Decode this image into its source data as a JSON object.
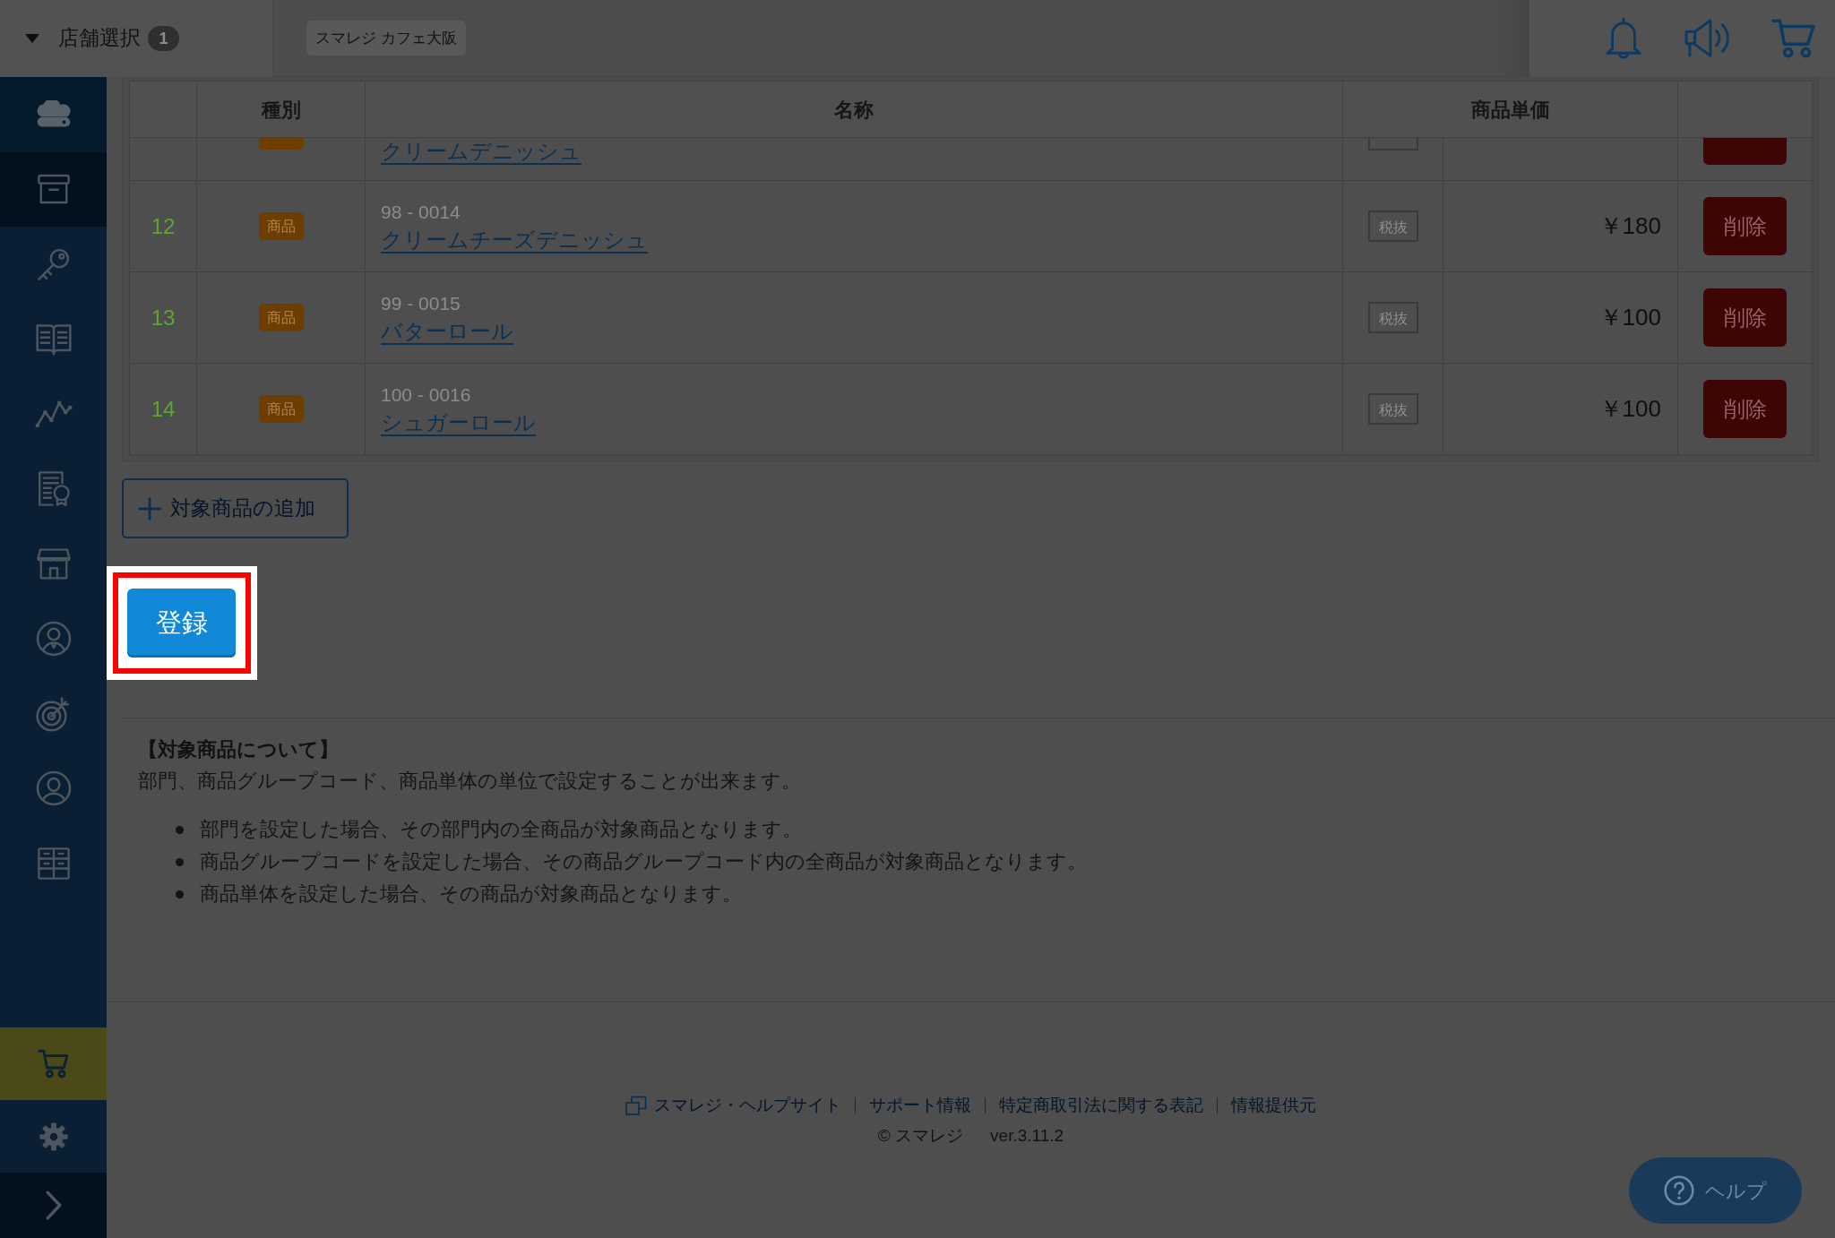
{
  "header": {
    "store_select": {
      "label": "店舗選択",
      "count": "1"
    },
    "store_name": "スマレジ カフェ大阪"
  },
  "sidebar": {
    "items": [
      {
        "selected": true
      },
      {
        "selected": false
      },
      {
        "selected": false
      },
      {
        "selected": false
      },
      {
        "selected": false
      },
      {
        "selected": false
      },
      {
        "selected": false
      },
      {
        "selected": false
      },
      {
        "selected": false
      },
      {
        "selected": false
      }
    ],
    "bottom_items": [
      {
        "selected": true
      },
      {
        "selected": false
      },
      {
        "selected": false
      }
    ]
  },
  "table": {
    "columns": [
      "種別",
      "名称",
      "商品単価"
    ],
    "rows": [
      {
        "kind": "cut",
        "name": "クリームデニッシュ"
      },
      {
        "kind": "full",
        "number": "12",
        "type": "商品",
        "code": "98 - 0014",
        "name": "クリームチーズデニッシュ",
        "tax": "税抜",
        "price": "￥180",
        "action": "削除"
      },
      {
        "kind": "full",
        "number": "13",
        "type": "商品",
        "code": "99 - 0015",
        "name": "バターロール",
        "tax": "税抜",
        "price": "￥100",
        "action": "削除"
      },
      {
        "kind": "full",
        "number": "14",
        "type": "商品",
        "code": "100 - 0016",
        "name": "シュガーロール",
        "tax": "税抜",
        "price": "￥100",
        "action": "削除"
      }
    ]
  },
  "add_button": {
    "label": "対象商品の追加"
  },
  "register_button": {
    "label": "登録",
    "highlighted": true
  },
  "notes": {
    "title": "【対象商品について】",
    "text": "部門、商品グループコード、商品単体の単位で設定することが出来ます。",
    "bullets": [
      "部門を設定した場合、その部門内の全商品が対象商品となります。",
      "商品グループコードを設定した場合、その商品グループコード内の全商品が対象商品となります。",
      "商品単体を設定した場合、その商品が対象商品となります。"
    ]
  },
  "footer": {
    "links": [
      "スマレジ・ヘルプサイト",
      "サポート情報",
      "特定商取引法に関する表記",
      "情報提供元"
    ],
    "copyright": "© スマレジ",
    "version": "ver.3.11.2"
  },
  "help_button": {
    "label": "ヘルプ"
  }
}
